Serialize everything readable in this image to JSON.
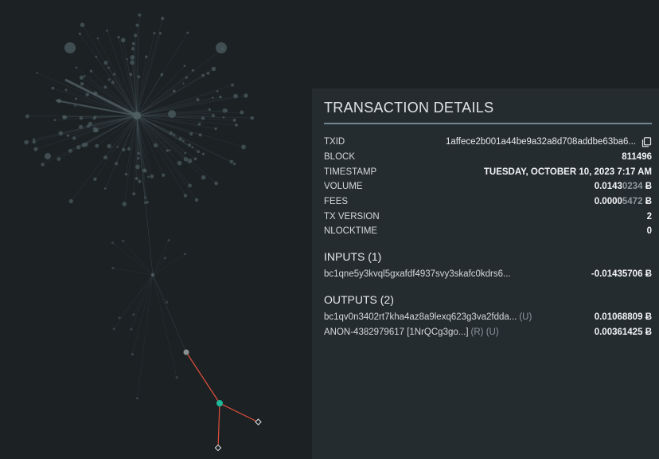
{
  "panel": {
    "title": "TRANSACTION DETAILS",
    "details": [
      {
        "label": "TXID",
        "value": "1affece2b001a44be9a32a8d708addbe63ba6...",
        "icon": "copy-icon"
      },
      {
        "label": "BLOCK",
        "value": "811496"
      },
      {
        "label": "TIMESTAMP",
        "value": "TUESDAY, OCTOBER 10, 2023 7:17 AM"
      },
      {
        "label": "VOLUME",
        "value_main": "0.0143",
        "value_dim": "0234",
        "unit": "Ƀ"
      },
      {
        "label": "FEES",
        "value_main": "0.0000",
        "value_dim": "5472",
        "unit": "Ƀ"
      },
      {
        "label": "TX VERSION",
        "value": "2"
      },
      {
        "label": "NLOCKTIME",
        "value": "0"
      }
    ],
    "inputs": {
      "title": "INPUTS (1)",
      "items": [
        {
          "address": "bc1qne5y3kvql5gxafdf4937svy3skafc0kdrs6...",
          "tag": "",
          "amount": "-0.01435706",
          "unit": "Ƀ"
        }
      ]
    },
    "outputs": {
      "title": "OUTPUTS (2)",
      "items": [
        {
          "address": "bc1qv0n3402rt7kha4az8a9lexq623g3va2fdda...",
          "tag": "(U)",
          "amount": "0.01068809",
          "unit": "Ƀ"
        },
        {
          "address": "ANON-4382979617 [1NrQCg3go...]",
          "tag": "(R) (U)",
          "amount": "0.00361425",
          "unit": "Ƀ"
        }
      ]
    }
  },
  "colors": {
    "background": "#1c2124",
    "panel": "#252c30",
    "edge_active": "#e0503c",
    "node_active": "#1fb89a",
    "graph_dim": "#4a5a5e"
  }
}
